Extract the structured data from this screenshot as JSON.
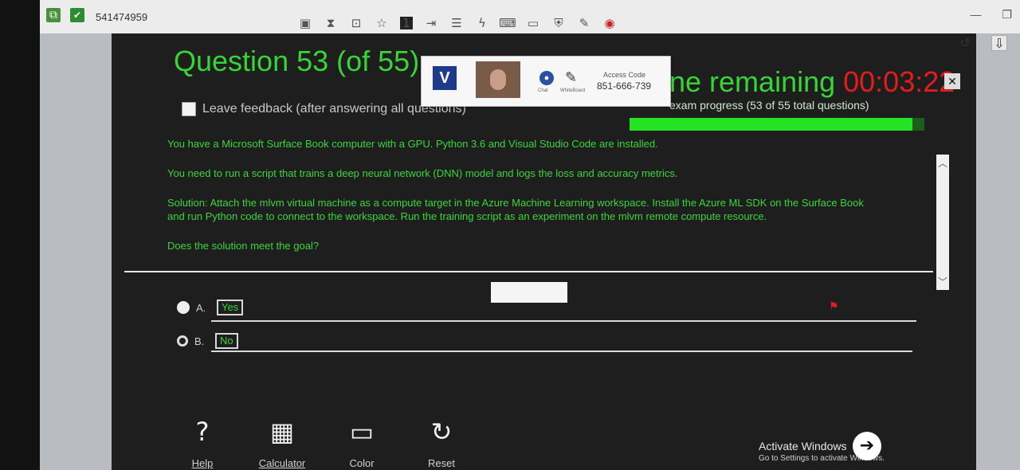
{
  "remote": {
    "session_id": "541474959",
    "badge_number": "1"
  },
  "popup": {
    "access_code_label": "Access Code",
    "access_code": "851-666-739",
    "chat_label": "Chat",
    "whiteboard_label": "WhiteBoard"
  },
  "exam": {
    "question_title": "Question 53 (of 55)",
    "time_remaining_label": "ne remaining",
    "time_remaining": "00:03:22",
    "close_label": "✕",
    "progress_label": "exam progress (53 of 55 total questions)",
    "progress_fraction": 0.96,
    "feedback_label": "Leave feedback (after answering all questions)",
    "question_paragraphs": [
      "You have a Microsoft Surface Book computer with a GPU. Python 3.6 and Visual Studio Code are installed.",
      "You need to run a script that trains a deep neural network (DNN) model and logs the loss and accuracy metrics.",
      "Solution: Attach the mlvm virtual machine as a compute target in the Azure Machine Learning workspace. Install the Azure ML SDK on the Surface Book and run Python code to connect to the workspace. Run the training script as an experiment on the mlvm remote compute resource.",
      "Does the solution meet the goal?"
    ],
    "answers": [
      {
        "letter": "A.",
        "text": "Yes"
      },
      {
        "letter": "B.",
        "text": "No"
      }
    ]
  },
  "tools": {
    "help": "Help",
    "calculator": "Calculator",
    "color": "Color",
    "reset": "Reset"
  },
  "watermark": {
    "line1": "Activate Windows",
    "line2": "Go to Settings to activate Windows."
  },
  "colors": {
    "accent_green": "#38d437",
    "timer_red": "#e11d1d",
    "background": "#1e1e1e"
  }
}
